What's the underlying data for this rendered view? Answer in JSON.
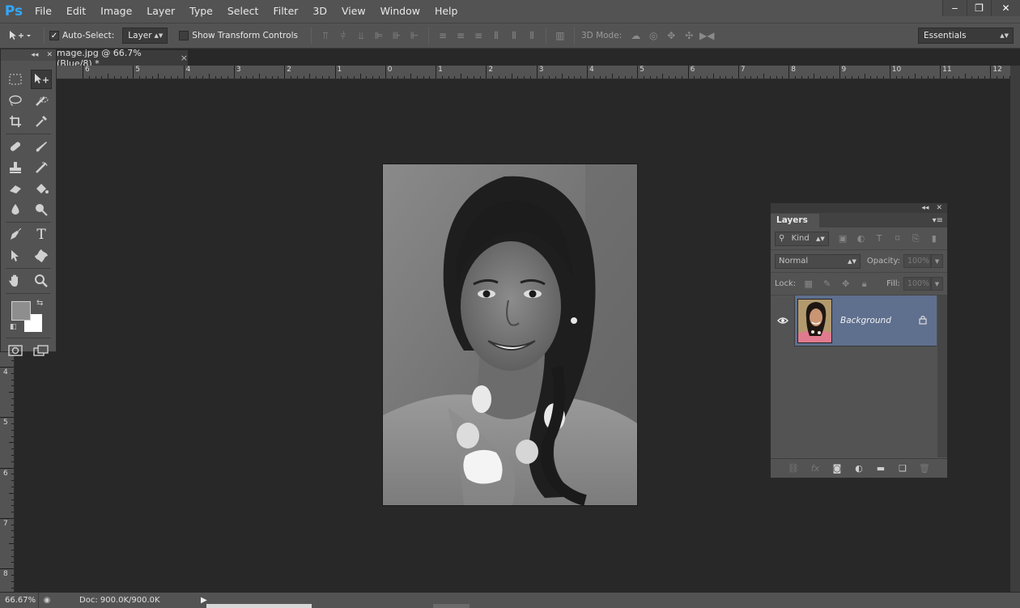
{
  "app": {
    "logo": "Ps",
    "menu": [
      "File",
      "Edit",
      "Image",
      "Layer",
      "Type",
      "Select",
      "Filter",
      "3D",
      "View",
      "Window",
      "Help"
    ],
    "window_controls": {
      "minimize": "‒",
      "restore": "❐",
      "close": "✕"
    }
  },
  "options_bar": {
    "tool_icon": "move-tool-icon",
    "auto_select_label": "Auto-Select:",
    "auto_select_checked": true,
    "auto_select_target": "Layer",
    "show_transform_label": "Show Transform Controls",
    "show_transform_checked": false,
    "mode_3d_label": "3D Mode:",
    "workspace": "Essentials"
  },
  "document": {
    "tab_title": "mage.jpg @ 66.7% (Blue/8) *",
    "tab_close": "×"
  },
  "rulers": {
    "horizontal": [
      "6",
      "5",
      "4",
      "3",
      "2",
      "1",
      "0",
      "1",
      "2",
      "3",
      "4",
      "5",
      "6",
      "7",
      "8",
      "9",
      "10",
      "11",
      "12"
    ],
    "vertical": [
      "4",
      "5",
      "6",
      "7",
      "8"
    ]
  },
  "tools": {
    "rows": [
      [
        "marquee-tool",
        "move-tool"
      ],
      [
        "lasso-tool",
        "quick-selection-tool"
      ],
      [
        "crop-tool",
        "eyedropper-tool"
      ],
      [
        "healing-brush-tool",
        "brush-tool"
      ],
      [
        "clone-stamp-tool",
        "history-brush-tool"
      ],
      [
        "eraser-tool",
        "paint-bucket-tool"
      ],
      [
        "blur-tool",
        "dodge-tool"
      ],
      [
        "pen-tool",
        "type-tool"
      ],
      [
        "path-selection-tool",
        "custom-shape-tool"
      ],
      [
        "hand-tool",
        "zoom-tool"
      ]
    ],
    "foreground_color": "#8e8e8e",
    "background_color": "#ffffff",
    "type_tool_glyph": "T"
  },
  "layers_panel": {
    "tab_label": "Layers",
    "filter_label": "Kind",
    "blend_mode": "Normal",
    "opacity_label": "Opacity:",
    "opacity_value": "100%",
    "lock_label": "Lock:",
    "fill_label": "Fill:",
    "fill_value": "100%",
    "layers": [
      {
        "name": "Background",
        "visible": true,
        "locked": true,
        "selected": true
      }
    ],
    "selected_color": "#5f6f8e"
  },
  "status_bar": {
    "zoom": "66.67%",
    "doc_info": "Doc: 900.0K/900.0K"
  }
}
